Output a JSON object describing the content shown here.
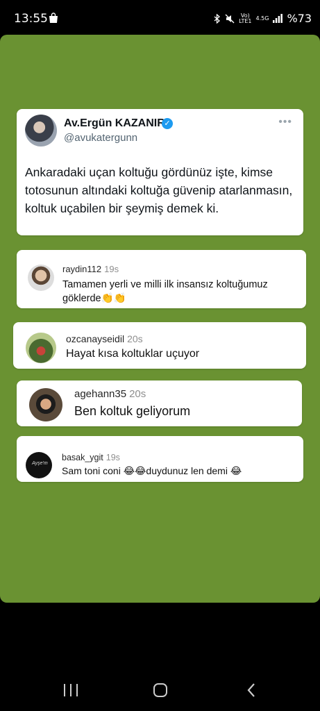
{
  "status_bar": {
    "time": "13:55",
    "net_line1": "Vo)",
    "net_line2": "LTE1",
    "net_speed": "4.5G",
    "battery": "%73",
    "icons": [
      "shopping-bag-icon",
      "bluetooth-icon",
      "mute-icon",
      "signal-icon"
    ]
  },
  "tweet": {
    "name": "Av.Ergün KAZANIR",
    "verified_mark": "✓",
    "handle": "@avukatergunn",
    "more": "•••",
    "text": "Ankaradaki uçan koltuğu gördünüz işte, kimse totosunun altındaki koltuğa güvenip atarlanmasın, koltuk uçabilen bir şeymiş demek ki."
  },
  "comments": [
    {
      "user": "raydin112",
      "ago": "19s",
      "text": "Tamamen yerli ve milli ilk insansız koltuğumuz göklerde👏👏"
    },
    {
      "user": "ozcanayseidil",
      "ago": "20s",
      "text": "Hayat kısa koltuklar uçuyor"
    },
    {
      "user": "agehann35",
      "ago": "20s",
      "text": "Ben koltuk geliyorum"
    },
    {
      "user": "basak_ygit",
      "ago": "19s",
      "text": "Sam toni coni 😂😂duydunuz len demi 😂",
      "avatar_text": "Ayşe'm"
    }
  ],
  "colors": {
    "story_bg": "#6a9232",
    "verified": "#1d9bf0"
  }
}
